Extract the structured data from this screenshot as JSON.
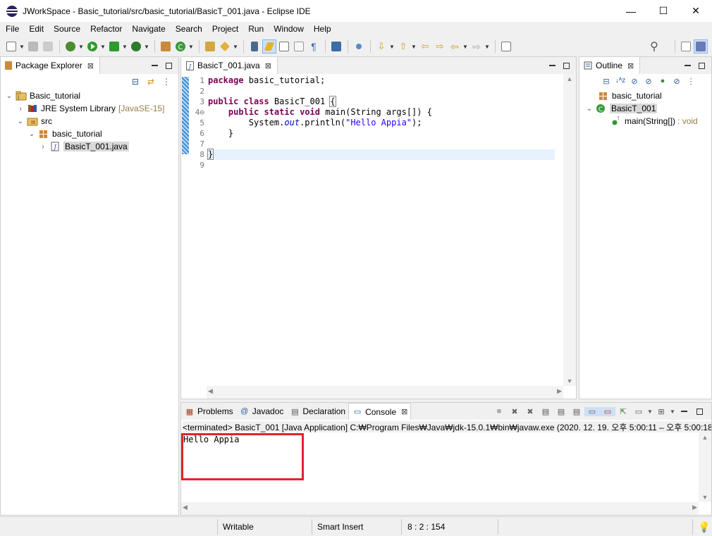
{
  "window": {
    "title": "JWorkSpace - Basic_tutorial/src/basic_tutorial/BasicT_001.java - Eclipse IDE",
    "controls": {
      "minimize": "—",
      "maximize": "☐",
      "close": "✕"
    }
  },
  "menu": [
    "File",
    "Edit",
    "Source",
    "Refactor",
    "Navigate",
    "Search",
    "Project",
    "Run",
    "Window",
    "Help"
  ],
  "package_explorer": {
    "tab_label": "Package Explorer",
    "tree": [
      {
        "arrow": "v",
        "label": "Basic_tutorial",
        "extra": ""
      },
      {
        "arrow": ">",
        "label": "JRE System Library",
        "extra": "[JavaSE-15]"
      },
      {
        "arrow": "v",
        "label": "src",
        "extra": ""
      },
      {
        "arrow": "v",
        "label": "basic_tutorial",
        "extra": ""
      },
      {
        "arrow": ">",
        "label": "BasicT_001.java",
        "extra": ""
      }
    ]
  },
  "editor": {
    "tab_label": "BasicT_001.java",
    "line_numbers": [
      "1",
      "2",
      "3",
      "4⊖",
      "5",
      "6",
      "7",
      "8",
      "9"
    ]
  },
  "outline": {
    "tab_label": "Outline",
    "items": [
      {
        "label": "basic_tutorial",
        "extra": ""
      },
      {
        "label": "BasicT_001",
        "extra": ""
      },
      {
        "label": "main(String[])",
        "extra": ": void",
        "modifier": "S"
      }
    ]
  },
  "console": {
    "tabs": [
      "Problems",
      "Javadoc",
      "Declaration",
      "Console"
    ],
    "tab_icons": [
      "▦",
      "@",
      "▤",
      "▭"
    ],
    "status_line": "<terminated> BasicT_001 [Java Application] C:₩Program Files₩Java₩jdk-15.0.1₩bin₩javaw.exe  (2020. 12. 19. 오후 5:00:11 – 오후 5:00:18)",
    "output": "Hello Appia"
  },
  "statusbar": {
    "writable": "Writable",
    "insert_mode": "Smart Insert",
    "position": "8 : 2 : 154"
  },
  "colors": {
    "keyword": "#7f0055",
    "string": "#2a00ff",
    "highlight_box": "#e8202a"
  }
}
